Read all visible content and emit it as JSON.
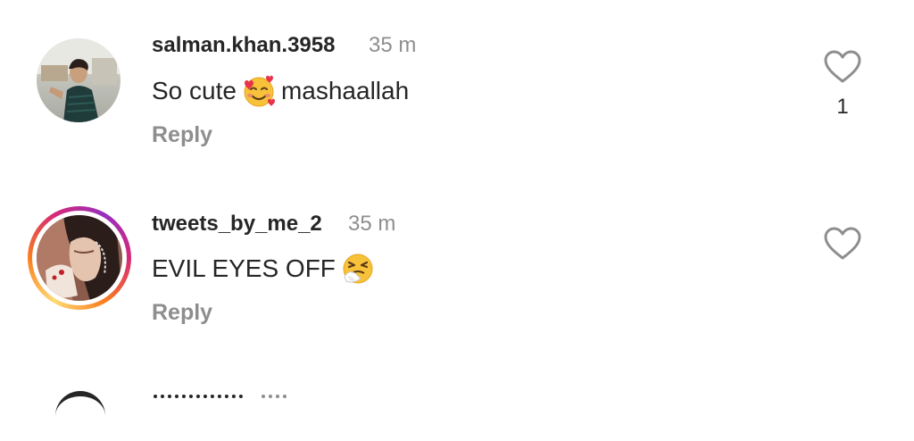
{
  "comments": [
    {
      "username": "salman.khan.3958",
      "time": "35 m",
      "text_before": "So cute",
      "emoji": "smiling-face-with-hearts",
      "text_after": "mashaallah",
      "reply_label": "Reply",
      "likes": "1"
    },
    {
      "username": "tweets_by_me_2",
      "time": "35 m",
      "text_before": "EVIL EYES OFF",
      "emoji": "sneezing-face",
      "text_after": "",
      "reply_label": "Reply",
      "likes": ""
    }
  ],
  "colors": {
    "primary_text": "#262626",
    "secondary_text": "#8e8e8e",
    "story_ring": [
      "#feda75",
      "#fa7e1e",
      "#d62976",
      "#962fbf"
    ]
  }
}
